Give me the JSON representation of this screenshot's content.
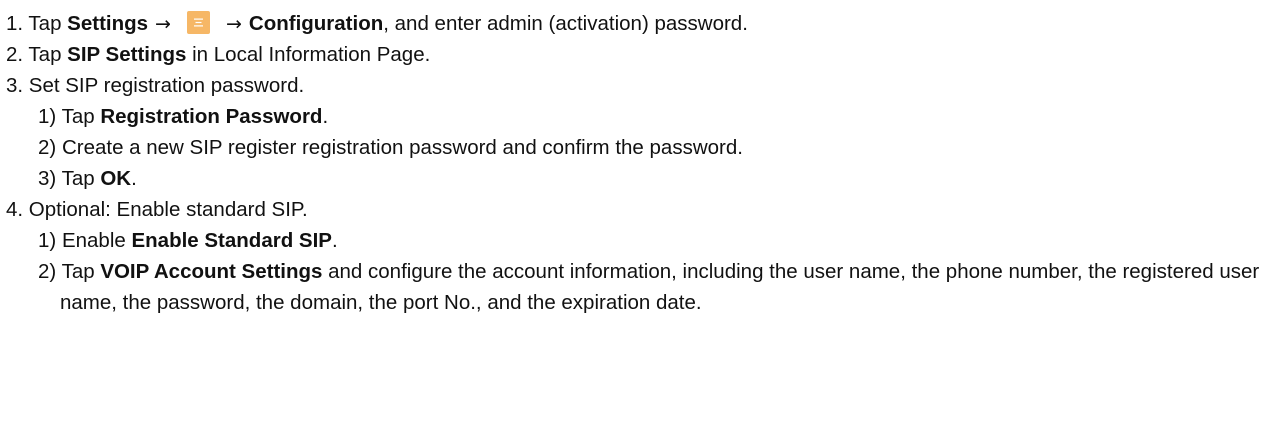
{
  "steps": [
    {
      "num": "1. ",
      "prefix": "Tap ",
      "bold1": "Settings",
      "arrow1": "→",
      "icon": "settings-menu-icon",
      "arrow2": "→",
      "bold2": "Configuration",
      "suffix": ", and enter admin (activation) password."
    },
    {
      "num": "2. ",
      "prefix": "Tap ",
      "bold": "SIP Settings",
      "suffix": " in Local Information Page."
    },
    {
      "num": "3. ",
      "text": "Set SIP registration password.",
      "substeps": [
        {
          "num": "1) ",
          "prefix": "Tap ",
          "bold": "Registration Password",
          "suffix": "."
        },
        {
          "num": "2) ",
          "text": "Create a new SIP register registration password and confirm the password."
        },
        {
          "num": "3) ",
          "prefix": "Tap ",
          "bold": "OK",
          "suffix": "."
        }
      ]
    },
    {
      "num": "4. ",
      "text": "Optional: Enable standard SIP.",
      "substeps": [
        {
          "num": "1) ",
          "prefix": "Enable ",
          "bold": "Enable Standard SIP",
          "suffix": "."
        },
        {
          "num": "2) ",
          "prefix": "Tap ",
          "bold": "VOIP Account Settings",
          "suffix": " and configure the account information, including the user name, the phone number, the registered user name, the password, the domain, the port No., and the expiration date."
        }
      ]
    }
  ],
  "colors": {
    "text": "#111111",
    "icon_background": "#f6b766",
    "icon_lines": "#ffffff"
  }
}
